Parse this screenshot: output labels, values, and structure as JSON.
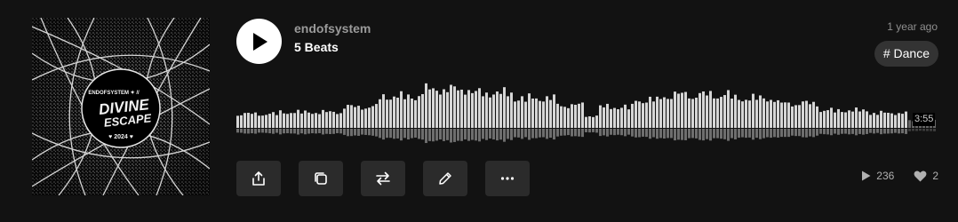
{
  "track": {
    "artist": "endofsystem",
    "title": "5 Beats",
    "posted": "1 year ago",
    "tag": "# Dance",
    "duration": "3:55"
  },
  "stats": {
    "plays": "236",
    "likes": "2"
  },
  "icons": {
    "play": "play-icon",
    "share": "share-icon",
    "copy": "copy-icon",
    "repost": "repost-icon",
    "edit": "pencil-icon",
    "more": "more-icon",
    "plays": "play-count-icon",
    "likes": "heart-icon"
  },
  "colors": {
    "background": "#121212",
    "waveform": "#d9d9d9",
    "button_bg": "#2b2b2b",
    "tag_bg": "#333333"
  }
}
